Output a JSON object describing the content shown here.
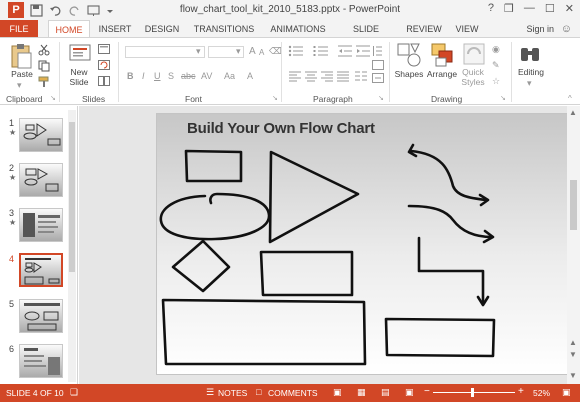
{
  "window": {
    "title": "flow_chart_tool_kit_2010_5183.pptx - PowerPoint",
    "controls": [
      "?",
      "❒",
      "—",
      "☐",
      "✕"
    ]
  },
  "tabs": [
    {
      "label": "FILE"
    },
    {
      "label": "HOME"
    },
    {
      "label": "INSERT"
    },
    {
      "label": "DESIGN"
    },
    {
      "label": "TRANSITIONS"
    },
    {
      "label": "ANIMATIONS"
    },
    {
      "label": "SLIDE SHOW"
    },
    {
      "label": "REVIEW"
    },
    {
      "label": "VIEW"
    }
  ],
  "active_tab": "HOME",
  "signin": "Sign in",
  "ribbon": {
    "clipboard": {
      "paste": "Paste",
      "group": "Clipboard"
    },
    "slides": {
      "new_slide_1": "New",
      "new_slide_2": "Slide",
      "group": "Slides"
    },
    "font": {
      "group": "Font"
    },
    "paragraph": {
      "group": "Paragraph"
    },
    "drawing": {
      "shapes": "Shapes",
      "arrange": "Arrange",
      "quick_styles_1": "Quick",
      "quick_styles_2": "Styles",
      "group": "Drawing"
    },
    "editing": {
      "label": "Editing"
    }
  },
  "thumbnails": [
    {
      "num": "1",
      "star": "★"
    },
    {
      "num": "2",
      "star": "★"
    },
    {
      "num": "3",
      "star": "★"
    },
    {
      "num": "4",
      "star": ""
    },
    {
      "num": "5",
      "star": ""
    },
    {
      "num": "6",
      "star": ""
    }
  ],
  "active_slide": 4,
  "slide": {
    "title": "Build Your Own Flow Chart"
  },
  "status": {
    "slide_indicator": "SLIDE 4 OF 10",
    "notes": "NOTES",
    "comments": "COMMENTS",
    "zoom": "52%"
  },
  "colors": {
    "accent": "#d24726",
    "ribbon_bg": "#ffffff",
    "titlebar_bg": "#f3f3f3"
  }
}
